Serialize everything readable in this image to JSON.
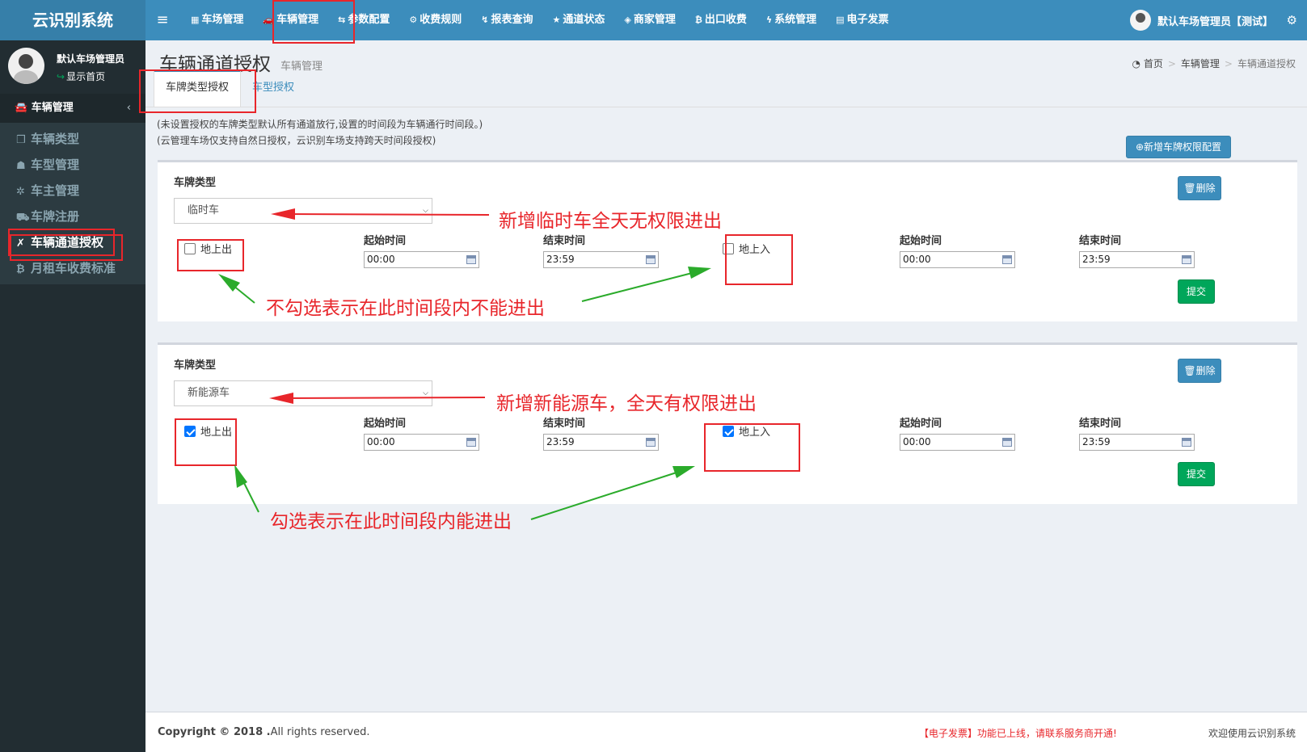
{
  "app": {
    "logo": "云识别系统",
    "menu_toggle": "≡"
  },
  "topnav": [
    {
      "label": "车场管理",
      "icon": "▦"
    },
    {
      "label": "车辆管理",
      "icon": "🚗"
    },
    {
      "label": "参数配置",
      "icon": "⇆"
    },
    {
      "label": "收费规则",
      "icon": "⚙"
    },
    {
      "label": "报表查询",
      "icon": "↯"
    },
    {
      "label": "通道状态",
      "icon": "★"
    },
    {
      "label": "商家管理",
      "icon": "◈"
    },
    {
      "label": "出口收费",
      "icon": "₿"
    },
    {
      "label": "系统管理",
      "icon": "ϟ"
    },
    {
      "label": "电子发票",
      "icon": "▤"
    }
  ],
  "user": {
    "name": "默认车场管理员【测试】",
    "gear": "⚙"
  },
  "sidebar": {
    "user_name": "默认车场管理员",
    "user_status": "显示首页",
    "section": "车辆管理",
    "section_chevron": "‹",
    "items": [
      {
        "label": "车辆类型",
        "icon": "❒"
      },
      {
        "label": "车型管理",
        "icon": "☗"
      },
      {
        "label": "车主管理",
        "icon": "✲"
      },
      {
        "label": "车牌注册",
        "icon": "⛟"
      },
      {
        "label": "车辆通道授权",
        "icon": "✗"
      },
      {
        "label": "月租车收费标准",
        "icon": "₿"
      }
    ]
  },
  "page": {
    "title": "车辆通道授权",
    "subtitle": "车辆管理",
    "breadcrumb": {
      "home": "首页",
      "mid": "车辆管理",
      "last": "车辆通道授权"
    },
    "tabs": [
      "车牌类型授权",
      "车型授权"
    ],
    "note1": "(未设置授权的车牌类型默认所有通道放行,设置的时间段为车辆通行时间段。)",
    "note2": "(云管理车场仅支持自然日授权，云识别车场支持跨天时间段授权)",
    "add_button": "新增车牌权限配置"
  },
  "panels": [
    {
      "plate_label": "车牌类型",
      "plate_value": "临时车",
      "out_label": "地上出",
      "out_checked": false,
      "in_label": "地上入",
      "in_checked": false,
      "start_label": "起始时间",
      "end_label": "结束时间",
      "out_start": "00:00",
      "out_end": "23:59",
      "in_start": "00:00",
      "in_end": "23:59",
      "delete": "删除",
      "submit": "提交"
    },
    {
      "plate_label": "车牌类型",
      "plate_value": "新能源车",
      "out_label": "地上出",
      "out_checked": true,
      "in_label": "地上入",
      "in_checked": true,
      "start_label": "起始时间",
      "end_label": "结束时间",
      "out_start": "00:00",
      "out_end": "23:59",
      "in_start": "00:00",
      "in_end": "23:59",
      "delete": "删除",
      "submit": "提交"
    }
  ],
  "annotations": {
    "a1": "新增临时车全天无权限进出",
    "a2": "不勾选表示在此时间段内不能进出",
    "a3": "新增新能源车，全天有权限进出",
    "a4": "勾选表示在此时间段内能进出"
  },
  "footer": {
    "copyright_bold": "Copyright © 2018 .",
    "copyright_rest": "All rights reserved.",
    "marquee": "【电子发票】功能已上线，请联系服务商开通!",
    "welcome": "欢迎使用云识别系统"
  },
  "colors": {
    "header": "#3c8dbc",
    "logo": "#367fa9",
    "sidebar": "#222d32",
    "annotation": "#e8262b",
    "arrow": "#2bab2b",
    "submit": "#00a65a"
  }
}
